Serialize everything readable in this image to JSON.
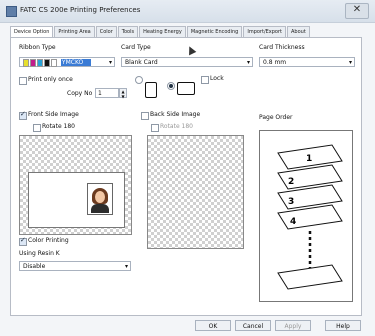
{
  "window": {
    "title": "FATC CS 200e Printing Preferences",
    "close_glyph": "✕"
  },
  "tabs": [
    {
      "label": "Device Option",
      "active": true
    },
    {
      "label": "Printing Area",
      "active": false
    },
    {
      "label": "Color",
      "active": false
    },
    {
      "label": "Tools",
      "active": false
    },
    {
      "label": "Heating Energy",
      "active": false
    },
    {
      "label": "Magnetic Encoding",
      "active": false
    },
    {
      "label": "Import/Export",
      "active": false
    },
    {
      "label": "About",
      "active": false
    }
  ],
  "ribbon": {
    "label": "Ribbon Type",
    "value": "YMCKO"
  },
  "card_type": {
    "label": "Card Type",
    "value": "Blank Card"
  },
  "thickness": {
    "label": "Card Thickness",
    "value": "0.8 mm"
  },
  "print_only_once": {
    "label": "Print only once",
    "checked": false
  },
  "copy": {
    "label": "Copy No",
    "value": "1"
  },
  "lock": {
    "label": "Lock",
    "checked": false
  },
  "front": {
    "label": "Front Side Image",
    "checked": true,
    "rotate_label": "Rotate 180",
    "rotate_checked": false
  },
  "back": {
    "label": "Back Side Image",
    "checked": false,
    "rotate_label": "Rotate 180",
    "rotate_checked": false
  },
  "page_order": {
    "label": "Page Order",
    "pages": [
      "1",
      "2",
      "3",
      "4"
    ]
  },
  "color_printing": {
    "label": "Color Printing",
    "checked": true
  },
  "resin": {
    "label": "Using Resin K",
    "value": "Disable"
  },
  "buttons": {
    "ok": "OK",
    "cancel": "Cancel",
    "apply": "Apply",
    "help": "Help"
  },
  "icons": {
    "arrow": "▾",
    "spin_up": "▲",
    "spin_down": "▼",
    "ribbon_swatches": [
      "#e7e02d",
      "#c21e8c",
      "#2aa3d7",
      "#111111",
      "#ffffff"
    ]
  }
}
